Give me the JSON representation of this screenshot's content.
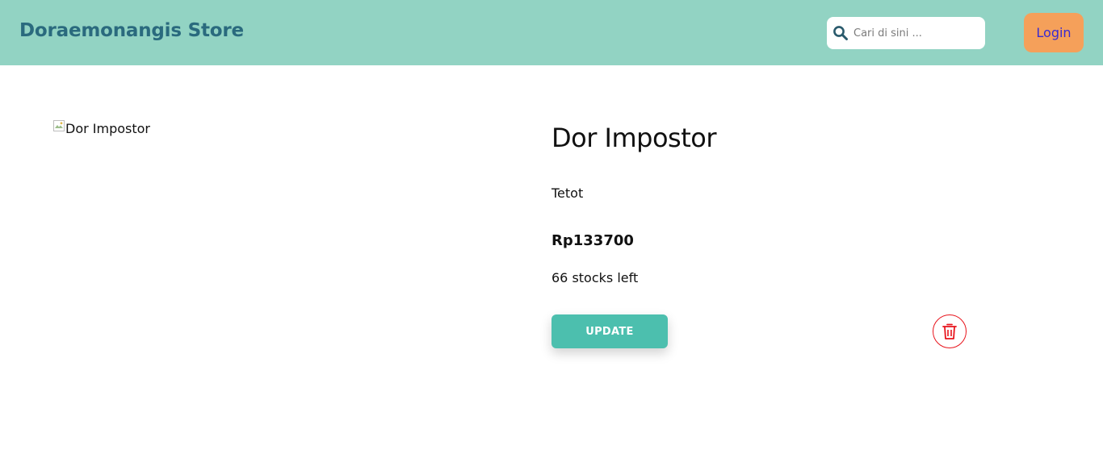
{
  "header": {
    "brand": "Doraemonangis Store",
    "search_placeholder": "Cari di sini ...",
    "search_icon": "search-icon",
    "login_label": "Login"
  },
  "product": {
    "image_alt": "Dor Impostor",
    "title": "Dor Impostor",
    "description": "Tetot",
    "price": "Rp133700",
    "stock": "66 stocks left",
    "update_label": "UPDATE",
    "delete_icon": "trash-icon"
  },
  "colors": {
    "navbar": "#92d3c3",
    "brand_text": "#2a6a7e",
    "login_bg": "#f5a05a",
    "login_text": "#3a2ad1",
    "update_bg": "#4cbfae",
    "delete_red": "#e8141c"
  }
}
